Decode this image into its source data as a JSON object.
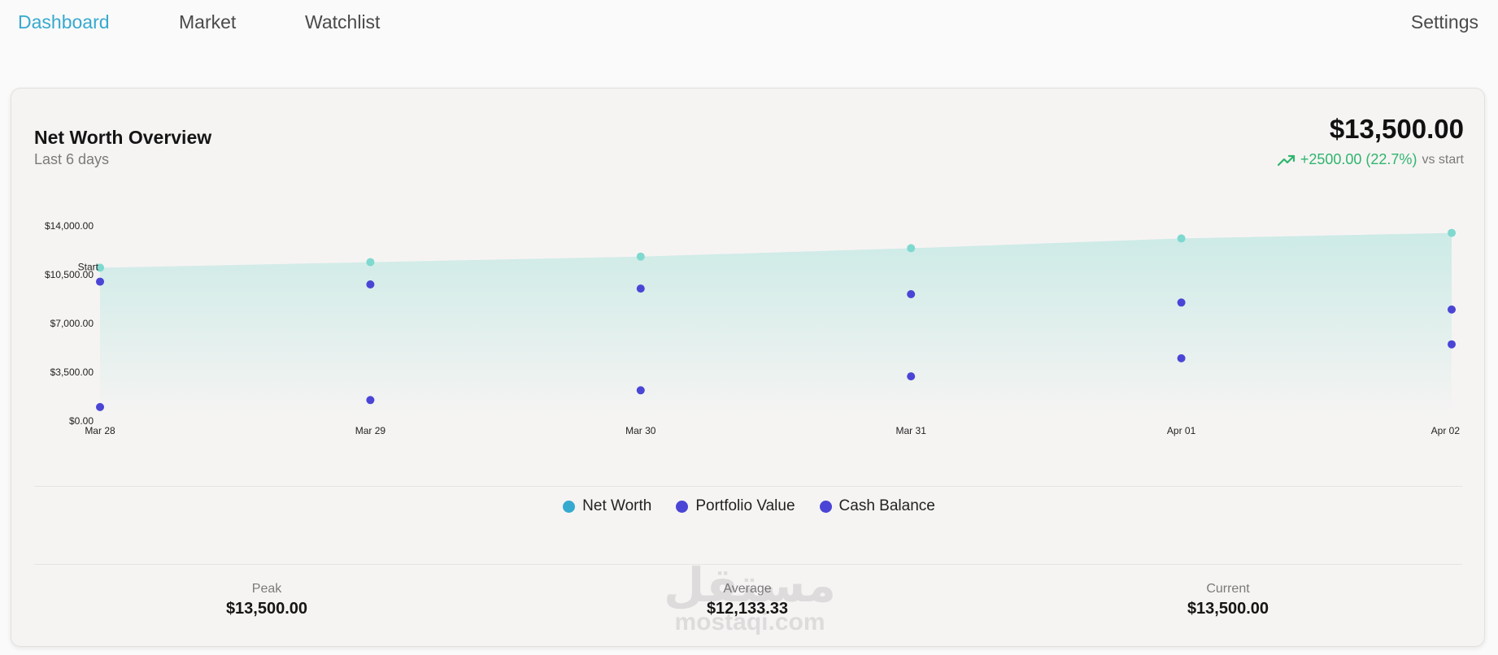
{
  "nav": {
    "dashboard": "Dashboard",
    "market": "Market",
    "watchlist": "Watchlist",
    "settings": "Settings",
    "active_color": "#36a9cf"
  },
  "overview": {
    "title": "Net Worth Overview",
    "subtitle": "Last 6 days",
    "value": "$13,500.00",
    "change": "+2500.00 (22.7%)",
    "change_suffix": "vs start",
    "change_icon": "trending-up-icon",
    "change_color": "#2fb56e"
  },
  "chart_data": {
    "type": "scatter",
    "categories": [
      "Mar 28",
      "Mar 29",
      "Mar 30",
      "Mar 31",
      "Apr 01",
      "Apr 02"
    ],
    "y_ticks": [
      "$0.00",
      "$3,500.00",
      "$7,000.00",
      "$10,500.00",
      "$14,000.00"
    ],
    "ylim": [
      0,
      14000
    ],
    "start_label": "Start",
    "series": [
      {
        "name": "Net Worth",
        "color": "#7fd9cf",
        "area": true,
        "values": [
          11000,
          11400,
          11800,
          12400,
          13100,
          13500
        ]
      },
      {
        "name": "Portfolio Value",
        "color": "#4b45d6",
        "values": [
          10000,
          9800,
          9500,
          9100,
          8500,
          8000
        ]
      },
      {
        "name": "Cash Balance",
        "color": "#4b45d6",
        "values": [
          1000,
          1500,
          2200,
          3200,
          4500,
          5500
        ]
      }
    ]
  },
  "legend": [
    {
      "label": "Net Worth",
      "color": "#36a9cf"
    },
    {
      "label": "Portfolio Value",
      "color": "#4b45d6"
    },
    {
      "label": "Cash Balance",
      "color": "#4b45d6"
    }
  ],
  "stats": {
    "peak_label": "Peak",
    "peak_value": "$13,500.00",
    "average_label": "Average",
    "average_value": "$12,133.33",
    "current_label": "Current",
    "current_value": "$13,500.00"
  },
  "watermark": {
    "arabic": "مستقل",
    "latin": "mostaqi.com"
  }
}
